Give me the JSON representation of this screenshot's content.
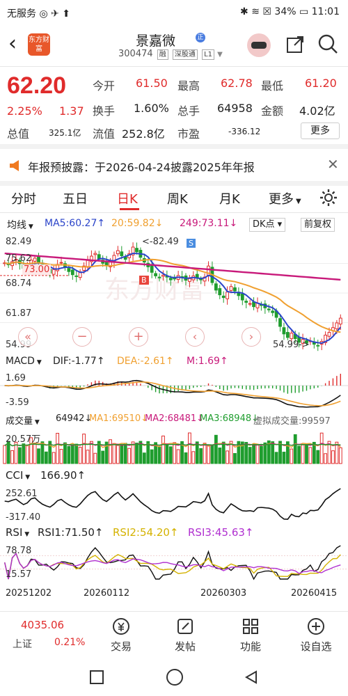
{
  "status_bar": {
    "left": "无服务 ◎ ✈ ⬆",
    "right": "✱ ≋ ☒ 34% ▭ 11:01"
  },
  "header": {
    "logo_text": "东方财富",
    "stock_name": "景嘉微",
    "stock_badge": "正",
    "stock_code": "300474",
    "tags": [
      "融",
      "深股通",
      "L1"
    ]
  },
  "quote": {
    "price": "62.20",
    "change_pct": "2.25%",
    "change": "1.37",
    "fields": [
      {
        "label": "今开",
        "value": "61.50",
        "color": "red"
      },
      {
        "label": "最高",
        "value": "62.78",
        "color": "red"
      },
      {
        "label": "最低",
        "value": "61.20",
        "color": "red"
      },
      {
        "label": "换手",
        "value": "1.60%",
        "color": "dark"
      },
      {
        "label": "总手",
        "value": "64958",
        "color": "dark"
      },
      {
        "label": "金额",
        "value": "4.02亿",
        "color": "dark"
      },
      {
        "label": "总值",
        "value": "325.1亿",
        "color": "dark"
      },
      {
        "label": "流值",
        "value": "252.8亿",
        "color": "dark"
      },
      {
        "label": "市盈",
        "value": "-336.12",
        "color": "dark"
      }
    ],
    "more_label": "更多"
  },
  "notice": {
    "text": "年报预披露：于2026-04-24披露2025年年报",
    "close": "✕"
  },
  "tabs": [
    "分时",
    "五日",
    "日K",
    "周K",
    "月K",
    "更多"
  ],
  "active_tab": "日K",
  "chart_toolbar": {
    "ma_label": "均线",
    "ma5": "MA5:60.27↑",
    "ma20": "20:59.82↓",
    "ma249": "249:73.11↓",
    "dk_label": "DK点",
    "fq_label": "前复权"
  },
  "colors": {
    "red": "#e02b2b",
    "green": "#1f9d2e",
    "blue": "#2b44c9",
    "orange": "#f0a030",
    "magenta": "#c8197a",
    "black": "#111111"
  },
  "chart_data": [
    {
      "type": "candlestick",
      "name": "日K",
      "y_ticks": [
        "82.49",
        "75.62",
        "68.74",
        "61.87",
        "54.99"
      ],
      "annotations": {
        "high": "82.49",
        "low": "54.99",
        "left_price": "73.00",
        "b_marker": "B",
        "s_marker": "S"
      },
      "close": [
        76.2,
        75.8,
        76.5,
        77.1,
        76.0,
        74.8,
        75.3,
        76.9,
        77.4,
        76.1,
        75.0,
        74.2,
        73.6,
        74.5,
        75.8,
        76.3,
        75.1,
        74.0,
        73.2,
        72.8,
        73.9,
        75.4,
        76.8,
        77.9,
        78.6,
        77.2,
        76.1,
        75.5,
        76.7,
        78.1,
        79.3,
        78.0,
        77.1,
        78.5,
        80.2,
        79.0,
        77.6,
        76.4,
        75.2,
        73.8,
        72.9,
        72.4,
        73.1,
        72.6,
        71.9,
        72.3,
        73.0,
        72.5,
        71.8,
        72.2,
        72.9,
        72.4,
        71.9,
        72.6,
        75.4,
        71.2,
        69.3,
        68.1,
        67.4,
        68.8,
        70.2,
        69.1,
        67.9,
        66.8,
        66.2,
        65.9,
        65.1,
        66.0,
        65.4,
        64.8,
        64.3,
        63.6,
        62.4,
        60.1,
        58.2,
        57.3,
        58.4,
        57.0,
        56.1,
        56.8,
        55.9,
        56.4,
        55.6,
        55.2,
        56.3,
        57.9,
        58.6,
        59.8,
        61.0,
        62.2
      ],
      "x_dates": [
        "20251202",
        "20260112",
        "20260303",
        "20260415"
      ]
    },
    {
      "type": "line",
      "name": "MACD",
      "series": [
        {
          "name": "DIF",
          "last": "-1.77↑"
        },
        {
          "name": "DEA",
          "last": "-2.61↑"
        },
        {
          "name": "M",
          "last": "1.69↑"
        }
      ],
      "y_ticks": [
        "1.69",
        "-3.59"
      ]
    },
    {
      "type": "bar",
      "name": "成交量",
      "series": [
        {
          "name": "成交量",
          "last": "64942↓"
        },
        {
          "name": "MA1",
          "last": "69510↓"
        },
        {
          "name": "MA2",
          "last": "68481↓"
        },
        {
          "name": "MA3",
          "last": "68948↓"
        },
        {
          "name": "虚拟成交量",
          "last": "99597"
        }
      ],
      "y_ticks": [
        "20.57万"
      ]
    },
    {
      "type": "line",
      "name": "CCI",
      "series": [
        {
          "name": "CCI",
          "last": "166.90↑"
        }
      ],
      "y_ticks": [
        "252.61",
        "-317.40"
      ]
    },
    {
      "type": "line",
      "name": "RSI",
      "series": [
        {
          "name": "RSI1",
          "last": "71.50↑"
        },
        {
          "name": "RSI2",
          "last": "54.20↑"
        },
        {
          "name": "RSI3",
          "last": "45.63↑"
        }
      ],
      "y_ticks": [
        "78.78",
        "15.57"
      ]
    }
  ],
  "indicators": {
    "macd": {
      "label": "MACD",
      "dif": "DIF:-1.77↑",
      "dea": "DEA:-2.61↑",
      "m": "M:1.69↑"
    },
    "vol": {
      "label": "成交量",
      "val": "64942↓",
      "ma1": "MA1:69510↓",
      "ma2": "MA2:68481↓",
      "ma3": "MA3:68948↓",
      "virtual": "虚拟成交量:99597"
    },
    "cci": {
      "label": "CCI",
      "val": "166.90↑"
    },
    "rsi": {
      "label": "RSI",
      "r1": "RSI1:71.50↑",
      "r2": "RSI2:54.20↑",
      "r3": "RSI3:45.63↑"
    }
  },
  "bottom_bar": {
    "index_value": "4035.06",
    "index_name": "上证",
    "index_pct": "0.21%",
    "buttons": [
      "交易",
      "发帖",
      "功能",
      "设自选"
    ]
  }
}
